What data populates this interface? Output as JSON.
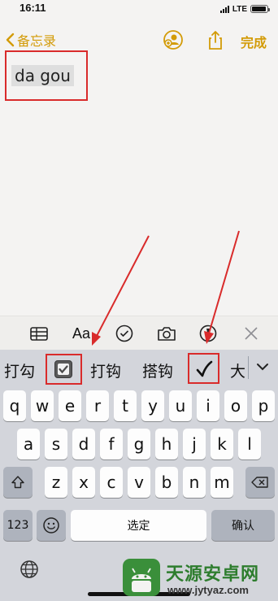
{
  "status_bar": {
    "time": "16:11",
    "network": "LTE",
    "battery_level": 0.95
  },
  "nav": {
    "back_label": "备忘录",
    "done_label": "完成",
    "accent_color": "#d39b07"
  },
  "note": {
    "text": "da gou"
  },
  "format_toolbar": {
    "icons": [
      "table-icon",
      "text-format-icon",
      "checklist-icon",
      "camera-icon",
      "markup-icon",
      "close-icon"
    ],
    "text_format_label": "Aa"
  },
  "candidates": {
    "items": [
      "打勾",
      "☑",
      "打钩",
      "搭钩",
      "✓",
      "大"
    ],
    "highlight_color": "#d92b2b"
  },
  "keyboard": {
    "row1": [
      "q",
      "w",
      "e",
      "r",
      "t",
      "y",
      "u",
      "i",
      "o",
      "p"
    ],
    "row2": [
      "a",
      "s",
      "d",
      "f",
      "g",
      "h",
      "j",
      "k",
      "l"
    ],
    "row3": [
      "z",
      "x",
      "c",
      "v",
      "b",
      "n",
      "m"
    ],
    "numbers_key": "123",
    "space_key": "选定",
    "return_key": "确认"
  },
  "watermark": {
    "title": "天源安卓网",
    "url": "www.jytyaz.com"
  }
}
